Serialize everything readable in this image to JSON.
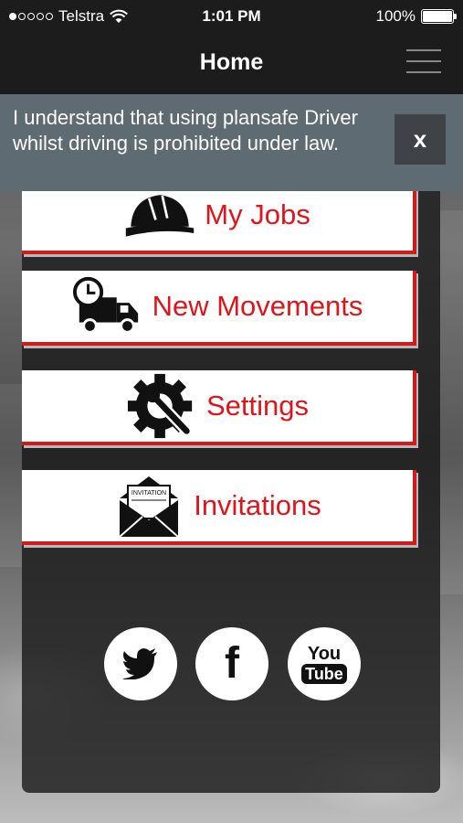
{
  "status_bar": {
    "carrier": "Telstra",
    "time": "1:01 PM",
    "battery": "100%"
  },
  "nav": {
    "title": "Home"
  },
  "banner": {
    "message": "I understand that using plansafe Driver whilst driving is prohibited under law.",
    "close_label": "x"
  },
  "menu": {
    "items": [
      {
        "label": "My Jobs",
        "icon": "hard-hat-icon"
      },
      {
        "label": "New Movements",
        "icon": "truck-clock-icon"
      },
      {
        "label": "Settings",
        "icon": "gear-wrench-icon"
      },
      {
        "label": "Invitations",
        "icon": "invitation-envelope-icon"
      }
    ],
    "invitation_icon_text": "INVITATION"
  },
  "social": {
    "items": [
      {
        "name": "twitter",
        "icon": "twitter-icon"
      },
      {
        "name": "facebook",
        "icon": "facebook-icon",
        "glyph": "f"
      },
      {
        "name": "youtube",
        "icon": "youtube-icon",
        "top": "You",
        "bottom": "Tube"
      }
    ]
  },
  "colors": {
    "accent_red": "#e0151b",
    "banner_bg": "#5f6b73",
    "nav_bg": "#1c1c1c"
  }
}
